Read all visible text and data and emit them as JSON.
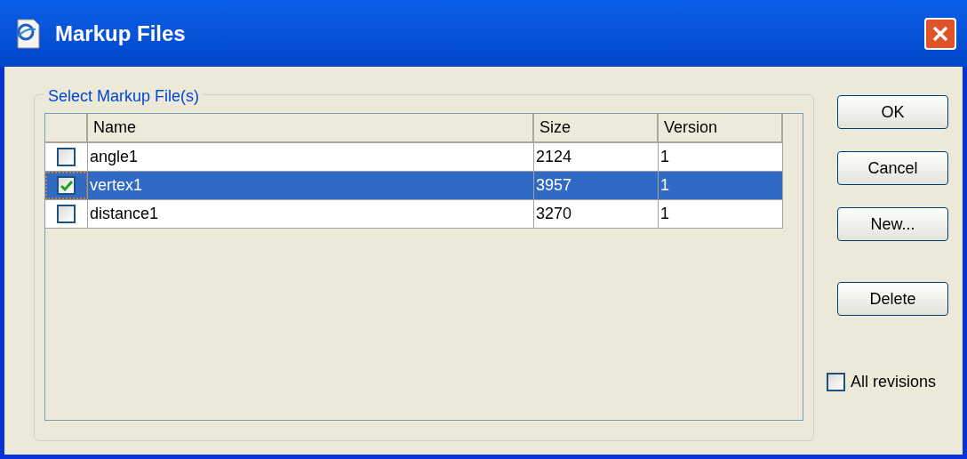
{
  "window": {
    "title": "Markup Files"
  },
  "group": {
    "label": "Select Markup File(s)"
  },
  "table": {
    "columns": [
      "Name",
      "Size",
      "Version"
    ],
    "rows": [
      {
        "checked": false,
        "selected": false,
        "cells": [
          "angle1",
          "2124",
          "1"
        ]
      },
      {
        "checked": true,
        "selected": true,
        "cells": [
          "vertex1",
          "3957",
          "1"
        ]
      },
      {
        "checked": false,
        "selected": false,
        "cells": [
          "distance1",
          "3270",
          "1"
        ]
      }
    ]
  },
  "buttons": [
    "OK",
    "Cancel",
    "New...",
    "Delete"
  ],
  "all_revisions": {
    "label": "All revisions",
    "checked": false
  }
}
